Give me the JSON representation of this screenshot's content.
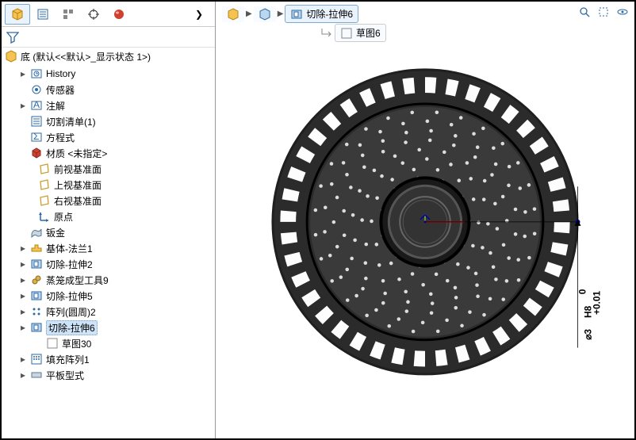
{
  "tabs": {
    "arrow": "❯"
  },
  "part": {
    "name": "底 (默认<<默认>_显示状态 1>)"
  },
  "tree": {
    "items": [
      {
        "label": "History",
        "indent": 22,
        "tw": "▸",
        "icon": "history-icon",
        "dn": "tree-item-history"
      },
      {
        "label": "传感器",
        "indent": 22,
        "tw": "",
        "icon": "sensor-icon",
        "dn": "tree-item-sensor"
      },
      {
        "label": "注解",
        "indent": 22,
        "tw": "▸",
        "icon": "annotation-icon",
        "dn": "tree-item-annotation"
      },
      {
        "label": "切割清单(1)",
        "indent": 22,
        "tw": "",
        "icon": "cutlist-icon",
        "dn": "tree-item-cutlist"
      },
      {
        "label": "方程式",
        "indent": 22,
        "tw": "",
        "icon": "equation-icon",
        "dn": "tree-item-equation"
      },
      {
        "label": "材质 <未指定>",
        "indent": 22,
        "tw": "",
        "icon": "material-icon",
        "dn": "tree-item-material"
      },
      {
        "label": "前视基准面",
        "indent": 32,
        "tw": "",
        "icon": "plane-icon",
        "dn": "tree-item-front-plane"
      },
      {
        "label": "上视基准面",
        "indent": 32,
        "tw": "",
        "icon": "plane-icon",
        "dn": "tree-item-top-plane"
      },
      {
        "label": "右视基准面",
        "indent": 32,
        "tw": "",
        "icon": "plane-icon",
        "dn": "tree-item-right-plane"
      },
      {
        "label": "原点",
        "indent": 32,
        "tw": "",
        "icon": "origin-icon",
        "dn": "tree-item-origin"
      },
      {
        "label": "钣金",
        "indent": 22,
        "tw": "",
        "icon": "sheetmetal-icon",
        "dn": "tree-item-sheetmetal"
      },
      {
        "label": "基体-法兰1",
        "indent": 22,
        "tw": "▸",
        "icon": "baseflange-icon",
        "dn": "tree-item-baseflange"
      },
      {
        "label": "切除-拉伸2",
        "indent": 22,
        "tw": "▸",
        "icon": "cut-icon",
        "dn": "tree-item-cut2"
      },
      {
        "label": "蒸笼成型工具9",
        "indent": 22,
        "tw": "▸",
        "icon": "formtool-icon",
        "dn": "tree-item-formtool"
      },
      {
        "label": "切除-拉伸5",
        "indent": 22,
        "tw": "▸",
        "icon": "cut-icon",
        "dn": "tree-item-cut5"
      },
      {
        "label": "阵列(圆周)2",
        "indent": 22,
        "tw": "▸",
        "icon": "pattern-icon",
        "dn": "tree-item-pattern2"
      },
      {
        "label": "切除-拉伸6",
        "indent": 22,
        "tw": "▸",
        "icon": "cut-icon",
        "dn": "tree-item-cut6",
        "sel": true
      },
      {
        "label": "草图30",
        "indent": 42,
        "tw": "",
        "icon": "sketch-icon",
        "dn": "tree-item-sketch30"
      },
      {
        "label": "填充阵列1",
        "indent": 22,
        "tw": "▸",
        "icon": "fillpattern-icon",
        "dn": "tree-item-fillpattern"
      },
      {
        "label": "平板型式",
        "indent": 22,
        "tw": "▸",
        "icon": "flatpattern-icon",
        "dn": "tree-item-flatpattern"
      }
    ]
  },
  "breadcrumb": {
    "items": [
      {
        "label": "",
        "icon": "part-icon"
      },
      {
        "label": "",
        "icon": "cube-icon"
      },
      {
        "label": "切除-拉伸6",
        "icon": "cut-icon",
        "last": true
      }
    ],
    "child": {
      "label": "草图6",
      "icon": "sketch-icon"
    }
  },
  "dim": {
    "value": "⌀3",
    "tol": "H8",
    "upper": "+0.01",
    "lower": "0"
  }
}
